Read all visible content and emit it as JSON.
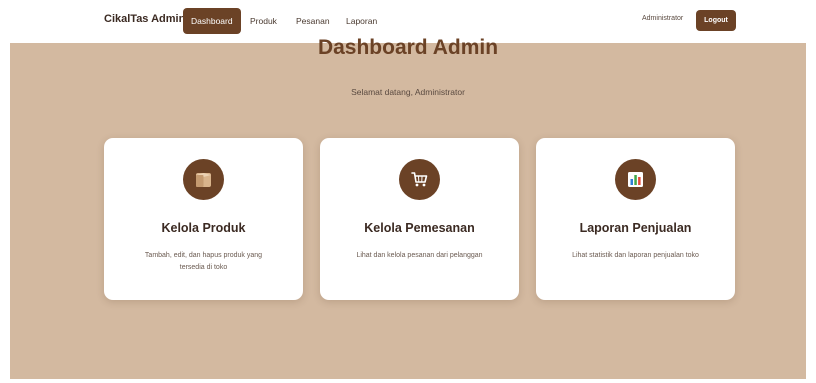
{
  "navbar": {
    "brand": "CikalTas Admin",
    "links": [
      {
        "label": "Dashboard",
        "active": true
      },
      {
        "label": "Produk",
        "active": false
      },
      {
        "label": "Pesanan",
        "active": false
      },
      {
        "label": "Laporan",
        "active": false
      }
    ],
    "user": "Administrator",
    "logout_label": "Logout"
  },
  "hero": {
    "title": "Dashboard Admin",
    "welcome": "Selamat datang, Administrator"
  },
  "cards": [
    {
      "icon": "box-icon",
      "title": "Kelola Produk",
      "description": "Tambah, edit, dan hapus produk yang tersedia di toko"
    },
    {
      "icon": "shopping-cart-icon",
      "title": "Kelola Pemesanan",
      "description": "Lihat dan kelola pesanan dari pelanggan"
    },
    {
      "icon": "bar-chart-icon",
      "title": "Laporan Penjualan",
      "description": "Lihat statistik dan laporan penjualan toko"
    }
  ],
  "colors": {
    "primary": "#6b4226",
    "hero_background": "#d3b9a0",
    "card_background": "#ffffff",
    "text_dark": "#3b2a22"
  }
}
